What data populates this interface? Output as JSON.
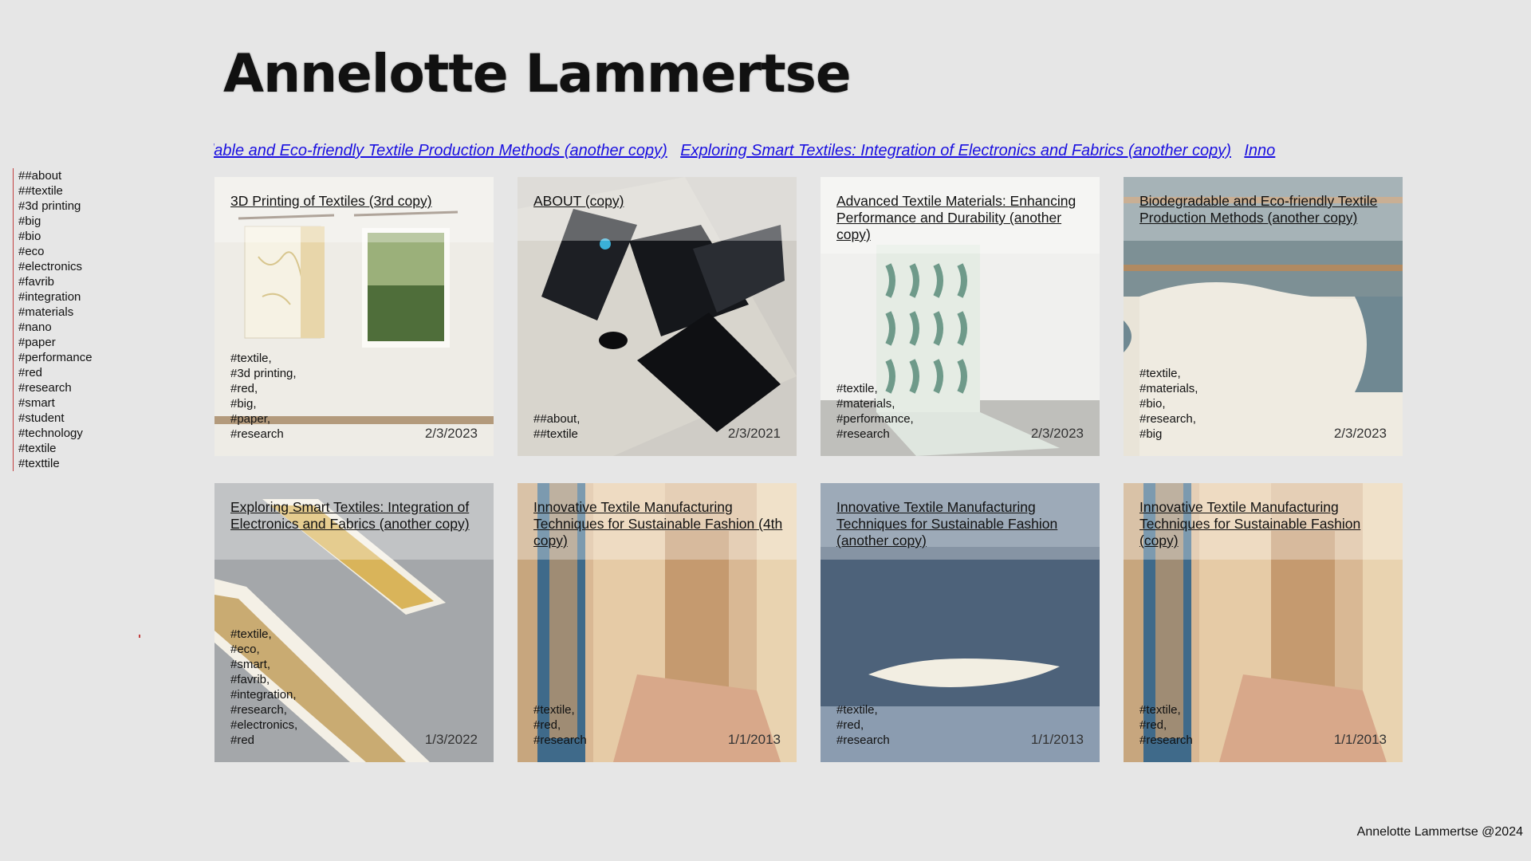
{
  "site": {
    "title": "Annelotte Lammertse",
    "footer": "Annelotte Lammertse @2024"
  },
  "marquee": {
    "links": [
      "degradable and Eco-friendly Textile Production Methods (another copy)",
      "Exploring Smart Textiles: Integration of Electronics and Fabrics (another copy)",
      "Inno"
    ],
    "link_color": "#1a10e0"
  },
  "tags": [
    "##about",
    "##textile",
    "#3d printing",
    "#big",
    "#bio",
    "#eco",
    "#electronics",
    "#favrib",
    "#integration",
    "#materials",
    "#nano",
    "#paper",
    "#performance",
    "#red",
    "#research",
    "#smart",
    "#student",
    "#technology",
    "#textile",
    "#texttile"
  ],
  "cards": [
    {
      "title": "3D Printing of Textiles (3rd copy)",
      "tags": [
        "#textile,",
        "#3d printing,",
        "#red,",
        "#big,",
        "#paper,",
        "#research"
      ],
      "date": "2/3/2023",
      "image": "print-hanging"
    },
    {
      "title": "ABOUT (copy)",
      "tags": [
        "##about,",
        "##textile"
      ],
      "date": "2/3/2021",
      "image": "laptop-desk"
    },
    {
      "title": "Advanced Textile Materials: Enhancing Performance and Durability (another copy)",
      "tags": [
        "#textile,",
        "#materials,",
        "#performance,",
        "#research"
      ],
      "date": "2/3/2023",
      "image": "hanging-textile"
    },
    {
      "title": "Biodegradable and Eco-friendly Textile Production Methods (another copy)",
      "tags": [
        "#textile,",
        "#materials,",
        "#bio,",
        "#research,",
        "#big"
      ],
      "date": "2/3/2023",
      "image": "loom"
    },
    {
      "title": "Exploring Smart Textiles: Integration of Electronics and Fabrics (another copy)",
      "tags": [
        "#textile,",
        "#eco,",
        "#smart,",
        "#favrib,",
        "#integration,",
        "#research,",
        "#electronics,",
        "#red"
      ],
      "date": "1/3/2022",
      "image": "floor-strips"
    },
    {
      "title": "Innovative Textile Manufacturing Techniques for Sustainable Fashion (4th copy)",
      "tags": [
        "#textile,",
        "#red,",
        "#research"
      ],
      "date": "1/1/2013",
      "image": "curtain-room"
    },
    {
      "title": "Innovative Textile Manufacturing Techniques for Sustainable Fashion (another copy)",
      "tags": [
        "#textile,",
        "#red,",
        "#research"
      ],
      "date": "1/1/2013",
      "image": "denim-texture"
    },
    {
      "title": "Innovative Textile Manufacturing Techniques for Sustainable Fashion (copy)",
      "tags": [
        "#textile,",
        "#red,",
        "#research"
      ],
      "date": "1/1/2013",
      "image": "curtain-room"
    }
  ]
}
